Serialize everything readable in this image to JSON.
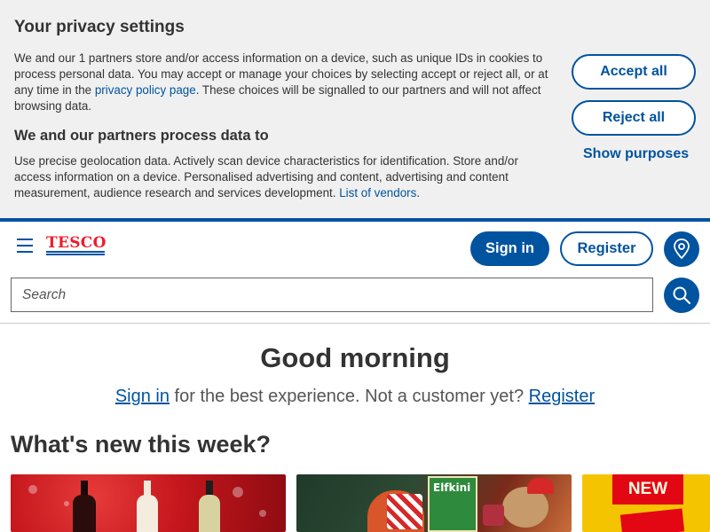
{
  "privacy": {
    "title": "Your privacy settings",
    "body1_pre": "We and our 1 partners store and/or access information on a device, such as unique IDs in cookies to process personal data. You may accept or manage your choices by selecting accept or reject all, or at any time in the ",
    "body1_link": "privacy policy page",
    "body1_post": ". These choices will be signalled to our partners and will not affect browsing data.",
    "subtitle": "We and our partners process data to",
    "body2_pre": "Use precise geolocation data. Actively scan device characteristics for identification. Store and/or access information on a device. Personalised advertising and content, advertising and content measurement, audience research and services development. ",
    "body2_link": "List of vendors",
    "body2_post": ".",
    "accept_label": "Accept all",
    "reject_label": "Reject all",
    "show_purposes_label": "Show purposes"
  },
  "header": {
    "logo_text": "TESCO",
    "signin_label": "Sign in",
    "register_label": "Register",
    "search_placeholder": "Search",
    "location_icon": "location-pin-icon",
    "search_icon": "search-icon",
    "menu_icon": "hamburger-menu-icon"
  },
  "main": {
    "greeting": "Good morning",
    "signin_link": "Sign in",
    "signin_middle": " for the best experience. Not a customer yet? ",
    "register_link": "Register",
    "section_title": "What's new this week?",
    "cards": [
      {
        "name": "wine-promo-card"
      },
      {
        "name": "christmas-gifts-card",
        "box_text": "Elfkini"
      },
      {
        "name": "new-products-card",
        "badge": "NEW"
      }
    ]
  },
  "colors": {
    "brand_blue": "#00539f",
    "brand_red": "#ee1c2e",
    "banner_bg": "#f0f0f0"
  }
}
